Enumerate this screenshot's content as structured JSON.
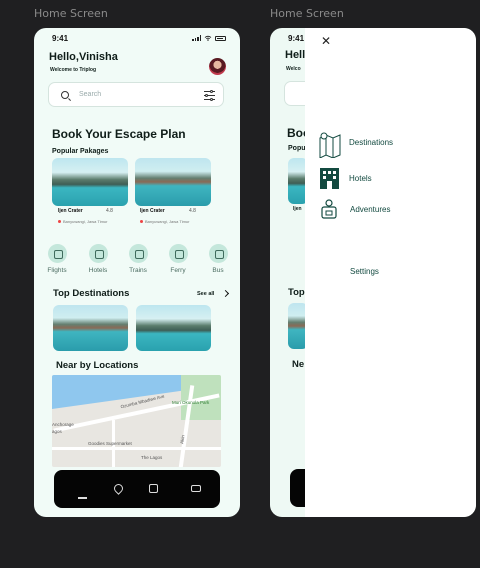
{
  "frames": [
    {
      "label": "Home Screen"
    },
    {
      "label": "Home Screen"
    }
  ],
  "home": {
    "time": "9:41",
    "greeting": "Hello,Vinisha",
    "welcome": "Welcome to Triplog",
    "search_placeholder": "Search",
    "headline": "Book Your Escape Plan",
    "popular_title": "Popular Pakages",
    "packages": [
      {
        "name": "Ijen Crater",
        "rating": "4.8",
        "location": "Banyuwangi, Jawa Timur"
      },
      {
        "name": "Ijen Crater",
        "rating": "4.8",
        "location": "Banyuwangi, Jawa Timur"
      }
    ],
    "categories": [
      {
        "label": "Flights",
        "icon": "plane-icon"
      },
      {
        "label": "Hotels",
        "icon": "hotel-icon"
      },
      {
        "label": "Trains",
        "icon": "train-icon"
      },
      {
        "label": "Ferry",
        "icon": "ferry-icon"
      },
      {
        "label": "Bus",
        "icon": "bus-icon"
      }
    ],
    "top_destinations_title": "Top Destinations",
    "see_all": "See all",
    "nearby_title": "Near by Locations",
    "map_labels": {
      "road": "Ozumba Mbadiwe Ave",
      "park": "Muri Okunola Park",
      "area1": "Anchorage",
      "area2": "agos",
      "store": "Goodies Supermarket",
      "place": "The Lagos",
      "road2": "Akin"
    },
    "nav_icons": [
      "home-icon",
      "location-icon",
      "buildings-icon",
      "ticket-icon"
    ]
  },
  "menu_screen": {
    "time": "9:41",
    "partial_greeting": "Hell",
    "partial_welcome": "Welco",
    "partial_headline": "Boo",
    "partial_popular": "Popu",
    "partial_top": "Top",
    "partial_near": "Ne",
    "items": [
      {
        "label": "Destinations",
        "icon": "map-icon"
      },
      {
        "label": "Hotels",
        "icon": "hotel-building-icon"
      },
      {
        "label": "Adventures",
        "icon": "hiker-icon"
      }
    ],
    "settings": "Settings"
  },
  "colors": {
    "accent": "#134a40",
    "background": "#f1fbf7",
    "nav": "#050505"
  }
}
